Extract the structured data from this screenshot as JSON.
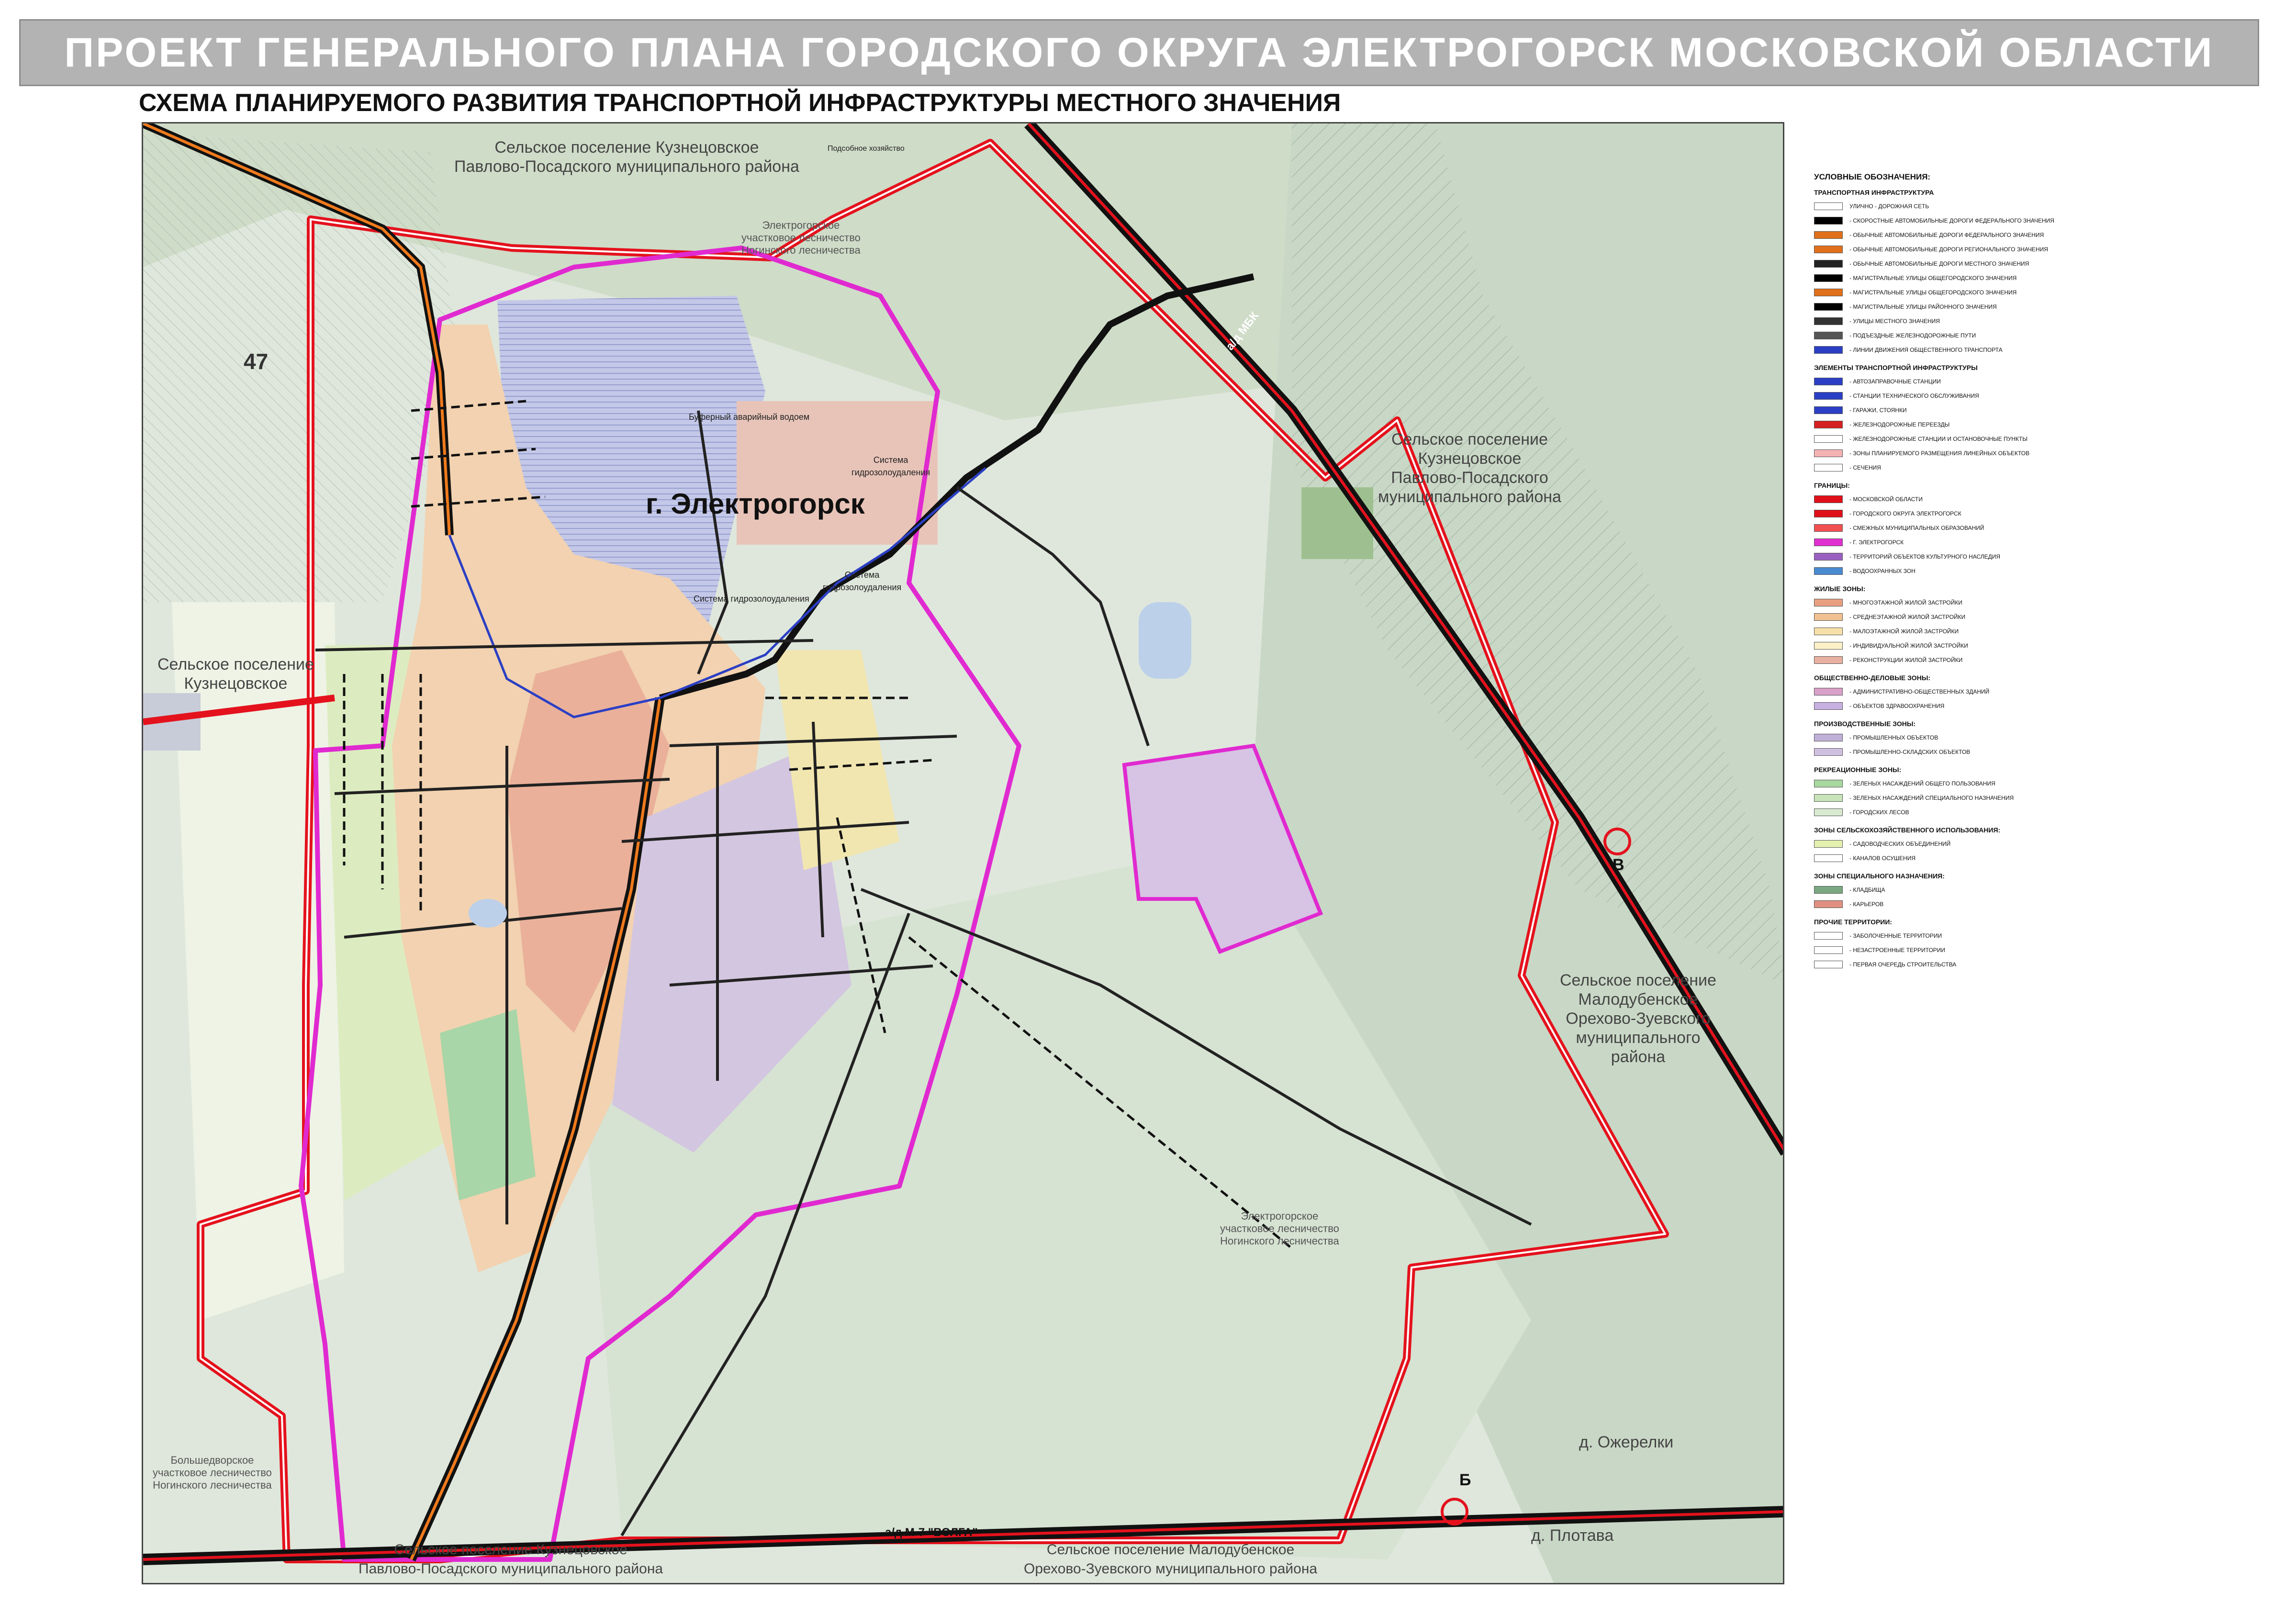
{
  "title": "ПРОЕКТ ГЕНЕРАЛЬНОГО ПЛАНА ГОРОДСКОГО ОКРУГА ЭЛЕКТРОГОРСК МОСКОВСКОЙ ОБЛАСТИ",
  "subtitle": "СХЕМА ПЛАНИРУЕМОГО РАЗВИТИЯ ТРАНСПОРТНОЙ ИНФРАСТРУКТУРЫ МЕСТНОГО ЗНАЧЕНИЯ",
  "map": {
    "city": "г. Электрогорск",
    "zone_number": "47",
    "roads": {
      "m7": "а/д М-7 \"ВОЛГА\"",
      "mbk": "а/д МБК"
    },
    "markers": {
      "b": "Б",
      "v": "В"
    },
    "labels": {
      "kuznetsovskoe_top": "Сельское поселение Кузнецовское\nПавлово-Посадского муниципального района",
      "kuznetsovskoe_left": "Сельское поселение\nКузнецовское",
      "kuznetsovskoe_right": "Сельское поселение\nКузнецовское\nПавлово-Посадского\nмуниципального района",
      "malodubenskoe_right": "Сельское поселение\nМалодубенское\nОрехово-Зуевского\nмуниципального\nрайона",
      "kuznetsovskoe_bottom": "Сельское поселение Кузнецовское\nПавлово-Посадского муниципального района",
      "malodubenskoe_bottom": "Сельское поселение Малодубенское\nОрехово-Зуевского муниципального района",
      "forestry_top": "Электрогорское\nучастковое лесничество\nНогинского лесничества",
      "forestry_mid": "Электрогорское\nучастковое лесничество\nНогинского лесничества",
      "forestry_left": "Большедворское\nучастковое лесничество\nНогинского лесничества",
      "ozherelki": "д. Ожерелки",
      "plotava": "д. Плотава",
      "buffer_reservoir": "Буферный аварийный водоем",
      "hydro_1": "Система\nгидрозолоудаления",
      "hydro_2": "Система гидрозолоудаления",
      "hydro_3": "Система\nгидрозолоудаления",
      "farm": "Подсобное хозяйство"
    }
  },
  "legend": {
    "title": "УСЛОВНЫЕ ОБОЗНАЧЕНИЯ:",
    "sections": [
      {
        "name": "ТРАНСПОРТНАЯ ИНФРАСТРУКТУРА",
        "items": [
          {
            "label": "УЛИЧНО - ДОРОЖНАЯ СЕТЬ",
            "color": "#ffffff"
          },
          {
            "label": "- СКОРОСТНЫЕ АВТОМОБИЛЬНЫЕ ДОРОГИ ФЕДЕРАЛЬНОГО ЗНАЧЕНИЯ",
            "color": "#000000"
          },
          {
            "label": "- ОБЫЧНЫЕ АВТОМОБИЛЬНЫЕ ДОРОГИ ФЕДЕРАЛЬНОГО ЗНАЧЕНИЯ",
            "color": "#e0701c"
          },
          {
            "label": "- ОБЫЧНЫЕ АВТОМОБИЛЬНЫЕ ДОРОГИ РЕГИОНАЛЬНОГО ЗНАЧЕНИЯ",
            "color": "#e0701c"
          },
          {
            "label": "- ОБЫЧНЫЕ АВТОМОБИЛЬНЫЕ ДОРОГИ МЕСТНОГО ЗНАЧЕНИЯ",
            "color": "#222222"
          },
          {
            "label": "- МАГИСТРАЛЬНЫЕ УЛИЦЫ ОБЩЕГОРОДСКОГО ЗНАЧЕНИЯ",
            "color": "#000000"
          },
          {
            "label": "- МАГИСТРАЛЬНЫЕ УЛИЦЫ ОБЩЕГОРОДСКОГО ЗНАЧЕНИЯ",
            "color": "#e0701c"
          },
          {
            "label": "- МАГИСТРАЛЬНЫЕ УЛИЦЫ РАЙОННОГО ЗНАЧЕНИЯ",
            "color": "#000000"
          },
          {
            "label": "- УЛИЦЫ МЕСТНОГО ЗНАЧЕНИЯ",
            "color": "#333333"
          },
          {
            "label": "- ПОДЪЕЗДНЫЕ ЖЕЛЕЗНОДОРОЖНЫЕ ПУТИ",
            "color": "#555555"
          },
          {
            "label": "- ЛИНИИ ДВИЖЕНИЯ ОБЩЕСТВЕННОГО ТРАНСПОРТА",
            "color": "#2b3fc4"
          }
        ]
      },
      {
        "name": "ЭЛЕМЕНТЫ ТРАНСПОРТНОЙ ИНФРАСТРУКТУРЫ",
        "items": [
          {
            "label": "- АВТОЗАПРАВОЧНЫЕ СТАНЦИИ",
            "color": "#2b3fc4"
          },
          {
            "label": "- СТАНЦИИ ТЕХНИЧЕСКОГО ОБСЛУЖИВАНИЯ",
            "color": "#2b3fc4"
          },
          {
            "label": "- ГАРАЖИ, СТОЯНКИ",
            "color": "#2b3fc4"
          },
          {
            "label": "- ЖЕЛЕЗНОДОРОЖНЫЕ ПЕРЕЕЗДЫ",
            "color": "#d42020"
          },
          {
            "label": "- ЖЕЛЕЗНОДОРОЖНЫЕ СТАНЦИИ И ОСТАНОВОЧНЫЕ ПУНКТЫ",
            "color": "#ffffff"
          },
          {
            "label": "- ЗОНЫ ПЛАНИРУЕМОГО РАЗМЕЩЕНИЯ ЛИНЕЙНЫХ ОБЪЕКТОВ",
            "color": "#f3b3b3"
          },
          {
            "label": "- СЕЧЕНИЯ",
            "color": "#ffffff"
          }
        ]
      },
      {
        "name": "ГРАНИЦЫ:",
        "items": [
          {
            "label": "- МОСКОВСКОЙ ОБЛАСТИ",
            "color": "#e0101a"
          },
          {
            "label": "- ГОРОДСКОГО ОКРУГА ЭЛЕКТРОГОРСК",
            "color": "#e0101a"
          },
          {
            "label": "- СМЕЖНЫХ МУНИЦИПАЛЬНЫХ ОБРАЗОВАНИЙ",
            "color": "#f05050"
          },
          {
            "label": "- Г. ЭЛЕКТРОГОРСК",
            "color": "#e030d0"
          },
          {
            "label": "- ТЕРРИТОРИЙ ОБЪЕКТОВ КУЛЬТУРНОГО НАСЛЕДИЯ",
            "color": "#9a60c0"
          },
          {
            "label": "- ВОДООХРАННЫХ ЗОН",
            "color": "#4a8ad0"
          }
        ]
      },
      {
        "name": "ЖИЛЫЕ ЗОНЫ:",
        "items": [
          {
            "label": "- МНОГОЭТАЖНОЙ ЖИЛОЙ ЗАСТРОЙКИ",
            "color": "#e8a080"
          },
          {
            "label": "- СРЕДНЕЭТАЖНОЙ ЖИЛОЙ ЗАСТРОЙКИ",
            "color": "#f0c090"
          },
          {
            "label": "- МАЛОЭТАЖНОЙ ЖИЛОЙ ЗАСТРОЙКИ",
            "color": "#f7e0a8"
          },
          {
            "label": "- ИНДИВИДУАЛЬНОЙ ЖИЛОЙ ЗАСТРОЙКИ",
            "color": "#fbf0c8"
          },
          {
            "label": "- РЕКОНСТРУКЦИИ ЖИЛОЙ ЗАСТРОЙКИ",
            "color": "#e8b0a0"
          }
        ]
      },
      {
        "name": "ОБЩЕСТВЕННО-ДЕЛОВЫЕ ЗОНЫ:",
        "items": [
          {
            "label": "- АДМИНИСТРАТИВНО-ОБЩЕСТВЕННЫХ ЗДАНИЙ",
            "color": "#d9a0c8"
          },
          {
            "label": "- ОБЪЕКТОВ ЗДРАВООХРАНЕНИЯ",
            "color": "#c8b0e0"
          }
        ]
      },
      {
        "name": "ПРОИЗВОДСТВЕННЫЕ ЗОНЫ:",
        "items": [
          {
            "label": "- ПРОМЫШЛЕННЫХ ОБЪЕКТОВ",
            "color": "#c0b0d8"
          },
          {
            "label": "- ПРОМЫШЛЕННО-СКЛАДСКИХ ОБЪЕКТОВ",
            "color": "#d0c0e0"
          }
        ]
      },
      {
        "name": "РЕКРЕАЦИОННЫЕ ЗОНЫ:",
        "items": [
          {
            "label": "- ЗЕЛЕНЫХ НАСАЖДЕНИЙ ОБЩЕГО ПОЛЬЗОВАНИЯ",
            "color": "#a8d8a0"
          },
          {
            "label": "- ЗЕЛЕНЫХ НАСАЖДЕНИЙ СПЕЦИАЛЬНОГО НАЗНАЧЕНИЯ",
            "color": "#c8e4b8"
          },
          {
            "label": "- ГОРОДСКИХ ЛЕСОВ",
            "color": "#d8ead0"
          }
        ]
      },
      {
        "name": "ЗОНЫ СЕЛЬСКОХОЗЯЙСТВЕННОГО ИСПОЛЬЗОВАНИЯ:",
        "items": [
          {
            "label": "- САДОВОДЧЕСКИХ ОБЪЕДИНЕНИЙ",
            "color": "#e4f0b0"
          },
          {
            "label": "- КАНАЛОВ ОСУШЕНИЯ",
            "color": "#ffffff"
          }
        ]
      },
      {
        "name": "ЗОНЫ СПЕЦИАЛЬНОГО НАЗНАЧЕНИЯ:",
        "items": [
          {
            "label": "- КЛАДБИЩА",
            "color": "#7aa880"
          },
          {
            "label": "- КАРЬЕРОВ",
            "color": "#e09080"
          }
        ]
      },
      {
        "name": "ПРОЧИЕ ТЕРРИТОРИИ:",
        "items": [
          {
            "label": "- ЗАБОЛОЧЕННЫЕ ТЕРРИТОРИИ",
            "color": "#ffffff"
          },
          {
            "label": "- НЕЗАСТРОЕННЫЕ ТЕРРИТОРИИ",
            "color": "#ffffff"
          },
          {
            "label": "- ПЕРВАЯ ОЧЕРЕДЬ СТРОИТЕЛЬСТВА",
            "color": "#ffffff"
          }
        ]
      }
    ]
  }
}
